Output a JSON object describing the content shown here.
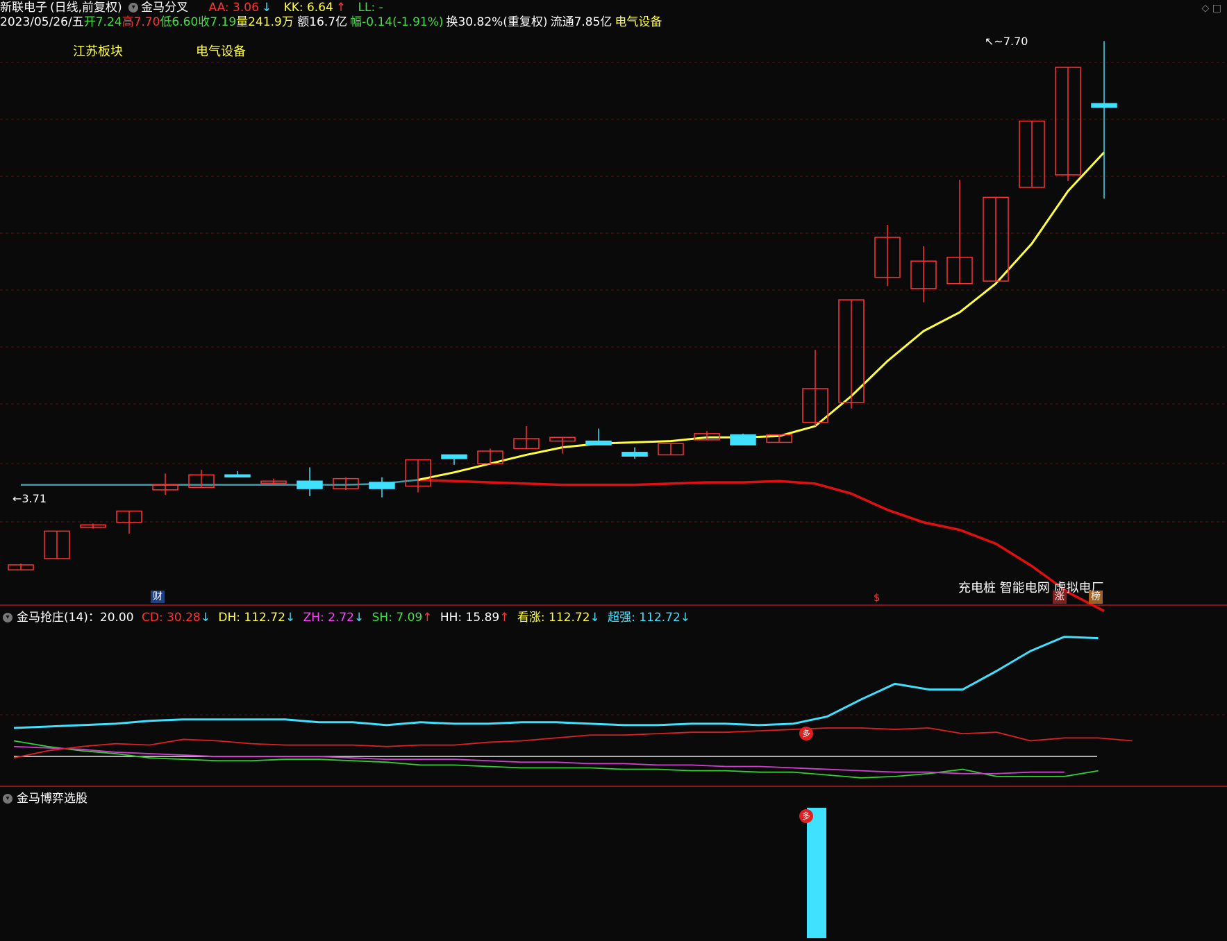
{
  "header": {
    "stock_name": "新联电子",
    "period": "(日线,前复权)",
    "indicator": "金马分叉",
    "aa": "AA: 3.06",
    "kk": "KK: 6.64",
    "ll": "LL: -",
    "date": "2023/05/26/五",
    "open": "开7.24",
    "high": "高7.70",
    "low": "低6.60",
    "close": "收7.19",
    "volume": "量241.9万",
    "amount": "额16.7亿",
    "change": "幅-0.14(-1.91%)",
    "turnover": "换30.82%(重复权)",
    "float": "流通7.85亿",
    "industry": "电气设备"
  },
  "tags": {
    "region": "江苏板块",
    "sector": "电气设备"
  },
  "concepts": "充电桩 智能电网 虚拟电厂",
  "markers": {
    "cai": "财",
    "s": "$",
    "zhang": "涨",
    "bang": "榜"
  },
  "price_labels": {
    "max": "7.70",
    "min": "3.71"
  },
  "panel2": {
    "title": "金马抢庄(14)：20.00",
    "cd": "CD: 30.28",
    "dh": "DH: 112.72",
    "zh": "ZH: 2.72",
    "sh": "SH: 7.09",
    "hh": "HH: 15.89",
    "kanzhang": "看涨: 112.72",
    "chaoqiang": "超强: 112.72",
    "signal": "多"
  },
  "panel3": {
    "title": "金马博弈选股",
    "signal": "多"
  },
  "colors": {
    "up": "#ff3232",
    "down": "#40e0ff",
    "ma_yellow": "#ffff40",
    "line_red": "#e01010",
    "line_cyan": "#40e0ff"
  },
  "chart_data": {
    "type": "candlestick",
    "price_range": [
      3.45,
      7.98
    ],
    "candles": [
      {
        "o": 3.71,
        "c": 3.75,
        "h": 3.76,
        "l": 3.71
      },
      {
        "o": 3.8,
        "c": 4.02,
        "h": 4.02,
        "l": 3.8
      },
      {
        "o": 4.05,
        "c": 4.07,
        "h": 4.08,
        "l": 4.04
      },
      {
        "o": 4.09,
        "c": 4.18,
        "h": 4.18,
        "l": 4.0
      },
      {
        "o": 4.35,
        "c": 4.39,
        "h": 4.48,
        "l": 4.31
      },
      {
        "o": 4.37,
        "c": 4.47,
        "h": 4.51,
        "l": 4.37
      },
      {
        "o": 4.47,
        "c": 4.46,
        "h": 4.5,
        "l": 4.45
      },
      {
        "o": 4.42,
        "c": 4.42,
        "h": 4.44,
        "l": 4.39
      },
      {
        "o": 4.42,
        "c": 4.36,
        "h": 4.53,
        "l": 4.3
      },
      {
        "o": 4.36,
        "c": 4.44,
        "h": 4.45,
        "l": 4.35
      },
      {
        "o": 4.41,
        "c": 4.36,
        "h": 4.45,
        "l": 4.29
      },
      {
        "o": 4.38,
        "c": 4.59,
        "h": 4.59,
        "l": 4.33
      },
      {
        "o": 4.63,
        "c": 4.6,
        "h": 4.63,
        "l": 4.55
      },
      {
        "o": 4.56,
        "c": 4.66,
        "h": 4.68,
        "l": 4.56
      },
      {
        "o": 4.68,
        "c": 4.76,
        "h": 4.86,
        "l": 4.68
      },
      {
        "o": 4.74,
        "c": 4.77,
        "h": 4.77,
        "l": 4.64
      },
      {
        "o": 4.74,
        "c": 4.71,
        "h": 4.84,
        "l": 4.71
      },
      {
        "o": 4.65,
        "c": 4.62,
        "h": 4.69,
        "l": 4.6
      },
      {
        "o": 4.63,
        "c": 4.72,
        "h": 4.72,
        "l": 4.63
      },
      {
        "o": 4.75,
        "c": 4.8,
        "h": 4.82,
        "l": 4.75
      },
      {
        "o": 4.79,
        "c": 4.71,
        "h": 4.8,
        "l": 4.71
      },
      {
        "o": 4.73,
        "c": 4.79,
        "h": 4.79,
        "l": 4.73
      },
      {
        "o": 4.89,
        "c": 5.16,
        "h": 5.47,
        "l": 4.86
      },
      {
        "o": 5.05,
        "c": 5.87,
        "h": 5.87,
        "l": 5.0
      },
      {
        "o": 6.05,
        "c": 6.37,
        "h": 6.47,
        "l": 5.98
      },
      {
        "o": 5.96,
        "c": 6.18,
        "h": 6.3,
        "l": 5.85
      },
      {
        "o": 6.0,
        "c": 6.21,
        "h": 6.83,
        "l": 6.0
      },
      {
        "o": 6.02,
        "c": 6.69,
        "h": 6.69,
        "l": 6.02
      },
      {
        "o": 6.77,
        "c": 7.3,
        "h": 7.3,
        "l": 6.77
      },
      {
        "o": 6.87,
        "c": 7.73,
        "h": 7.73,
        "l": 6.82
      },
      {
        "o": 7.44,
        "c": 7.41,
        "h": 7.94,
        "l": 6.68
      }
    ],
    "ma_yellow": [
      null,
      null,
      null,
      null,
      null,
      null,
      null,
      null,
      null,
      null,
      null,
      4.43,
      4.49,
      4.56,
      4.63,
      4.69,
      4.72,
      4.73,
      4.74,
      4.77,
      4.77,
      4.78,
      4.86,
      5.1,
      5.38,
      5.62,
      5.77,
      6.0,
      6.32,
      6.74,
      7.05
    ],
    "upper_cyan": [
      4.39,
      4.39,
      4.39,
      4.39,
      4.39,
      4.39,
      4.39,
      4.39,
      4.39,
      4.39,
      4.4,
      4.43
    ],
    "lower_red": [
      null,
      null,
      null,
      null,
      null,
      null,
      null,
      null,
      null,
      null,
      null,
      4.43,
      4.42,
      4.41,
      4.4,
      4.39,
      4.39,
      4.39,
      4.4,
      4.41,
      4.41,
      4.42,
      4.4,
      4.32,
      4.19,
      4.09,
      4.03,
      3.92,
      3.74,
      3.53,
      3.38
    ],
    "panel2_cyan": [
      25,
      26,
      27,
      28,
      30,
      31,
      31,
      31,
      31,
      29,
      29,
      27,
      29,
      28,
      28,
      29,
      29,
      28,
      27,
      27,
      28,
      28,
      27,
      28,
      33,
      45,
      56,
      52,
      52,
      65,
      79,
      89,
      88
    ],
    "panel2_red": [
      4,
      9,
      12,
      14,
      13,
      17,
      16,
      14,
      13,
      13,
      13,
      12,
      13,
      13,
      15,
      16,
      18,
      20,
      20,
      21,
      22,
      22,
      23,
      24,
      25,
      25,
      24,
      25,
      21,
      22,
      16,
      18,
      18,
      16
    ],
    "panel2_purple": [
      12,
      11,
      10,
      8,
      7,
      6,
      5,
      5,
      5,
      5,
      4,
      3,
      3,
      3,
      2,
      1,
      1,
      0,
      0,
      -1,
      -1,
      -2,
      -2,
      -3,
      -4,
      -5,
      -6,
      -6,
      -7,
      -7,
      -6,
      -6
    ],
    "panel2_green": [
      16,
      12,
      9,
      7,
      4,
      3,
      2,
      2,
      3,
      3,
      2,
      1,
      -1,
      -1,
      -2,
      -3,
      -3,
      -3,
      -4,
      -4,
      -5,
      -5,
      -6,
      -6,
      -8,
      -10,
      -9,
      -7,
      -4,
      -9,
      -9,
      -9,
      -5
    ],
    "panel2_range": [
      -12,
      100
    ],
    "panel3_bar_index": 22
  }
}
